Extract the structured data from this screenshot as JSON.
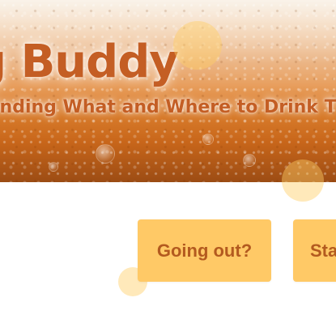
{
  "hero": {
    "title": "g Buddy",
    "subtitle": "inding What and Where to Drink T"
  },
  "actions": {
    "going_out_label": "Going out?",
    "start_label": "Sta"
  },
  "colors": {
    "accent_text": "#c45e24",
    "button_bg": "#ffc966",
    "button_text": "#b35a1f"
  }
}
